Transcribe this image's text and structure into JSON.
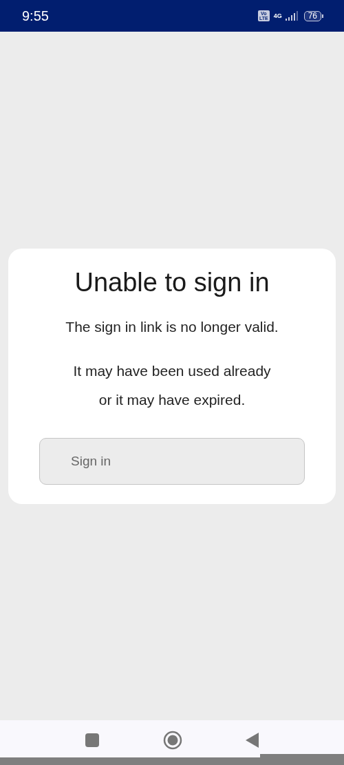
{
  "status_bar": {
    "time": "9:55",
    "volte_badge": [
      "Vo",
      "LTE"
    ],
    "network": "4G",
    "battery": "76"
  },
  "card": {
    "title": "Unable to sign in",
    "paragraphs": [
      "The sign in link is no longer valid.",
      "It may have been used already or it may have expired."
    ],
    "button": "Sign in"
  },
  "nav_bar": {
    "buttons": [
      {
        "kind": "recents"
      },
      {
        "kind": "home"
      },
      {
        "kind": "back"
      }
    ]
  }
}
